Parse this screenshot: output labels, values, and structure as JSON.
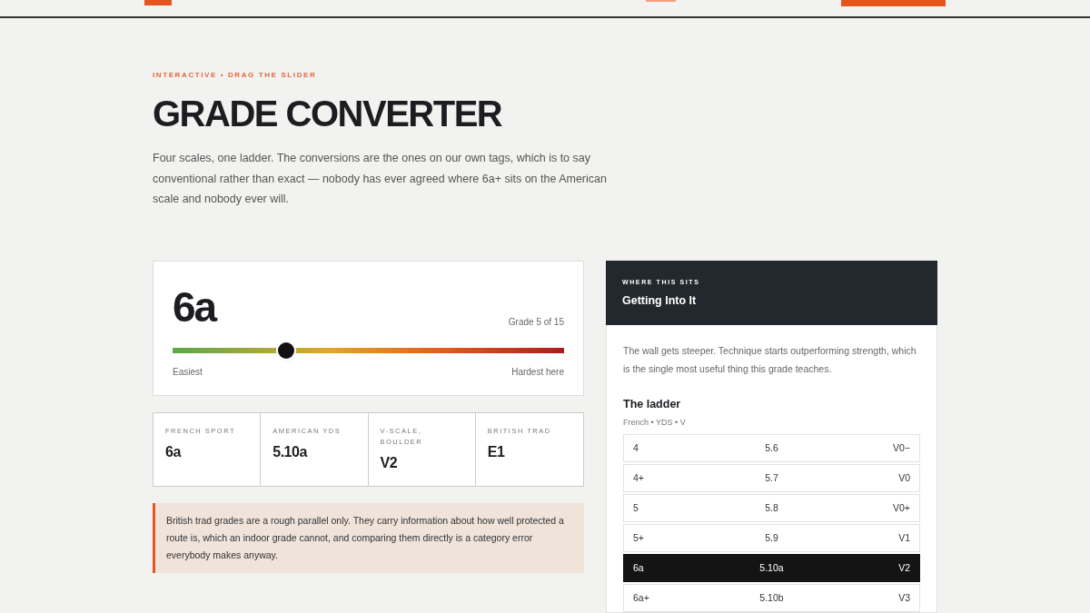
{
  "eyebrow": "INTERACTIVE • DRAG THE SLIDER",
  "title": "GRADE CONVERTER",
  "intro": "Four scales, one ladder. The conversions are the ones on our own tags, which is to say conventional rather than exact — nobody has ever agreed where 6a+ sits on the American scale and nobody ever will.",
  "converter": {
    "grade": "6a",
    "position": "Grade 5 of 15",
    "level": 0.29,
    "min_label": "Easiest",
    "max_label": "Hardest here"
  },
  "scales": [
    {
      "label": "FRENCH SPORT",
      "value": "6a"
    },
    {
      "label": "AMERICAN YDS",
      "value": "5.10a"
    },
    {
      "label": "V-SCALE, BOULDER",
      "value": "V2"
    },
    {
      "label": "BRITISH TRAD",
      "value": "E1"
    }
  ],
  "note": "British trad grades are a rough parallel only. They carry information about how well protected a route is, which an indoor grade cannot, and comparing them directly is a category error everybody makes anyway.",
  "panel": {
    "eyebrow": "WHERE THIS SITS",
    "heading": "Getting Into It",
    "description": "The wall gets steeper. Technique starts outperforming strength, which is the single most useful thing this grade teaches.",
    "ladder_title": "The ladder",
    "ladder_legend": "French • YDS • V",
    "rows": [
      {
        "french": "4",
        "yds": "5.6",
        "v": "V0−",
        "selected": false
      },
      {
        "french": "4+",
        "yds": "5.7",
        "v": "V0",
        "selected": false
      },
      {
        "french": "5",
        "yds": "5.8",
        "v": "V0+",
        "selected": false
      },
      {
        "french": "5+",
        "yds": "5.9",
        "v": "V1",
        "selected": false
      },
      {
        "french": "6a",
        "yds": "5.10a",
        "v": "V2",
        "selected": true
      },
      {
        "french": "6a+",
        "yds": "5.10b",
        "v": "V3",
        "selected": false
      }
    ]
  }
}
